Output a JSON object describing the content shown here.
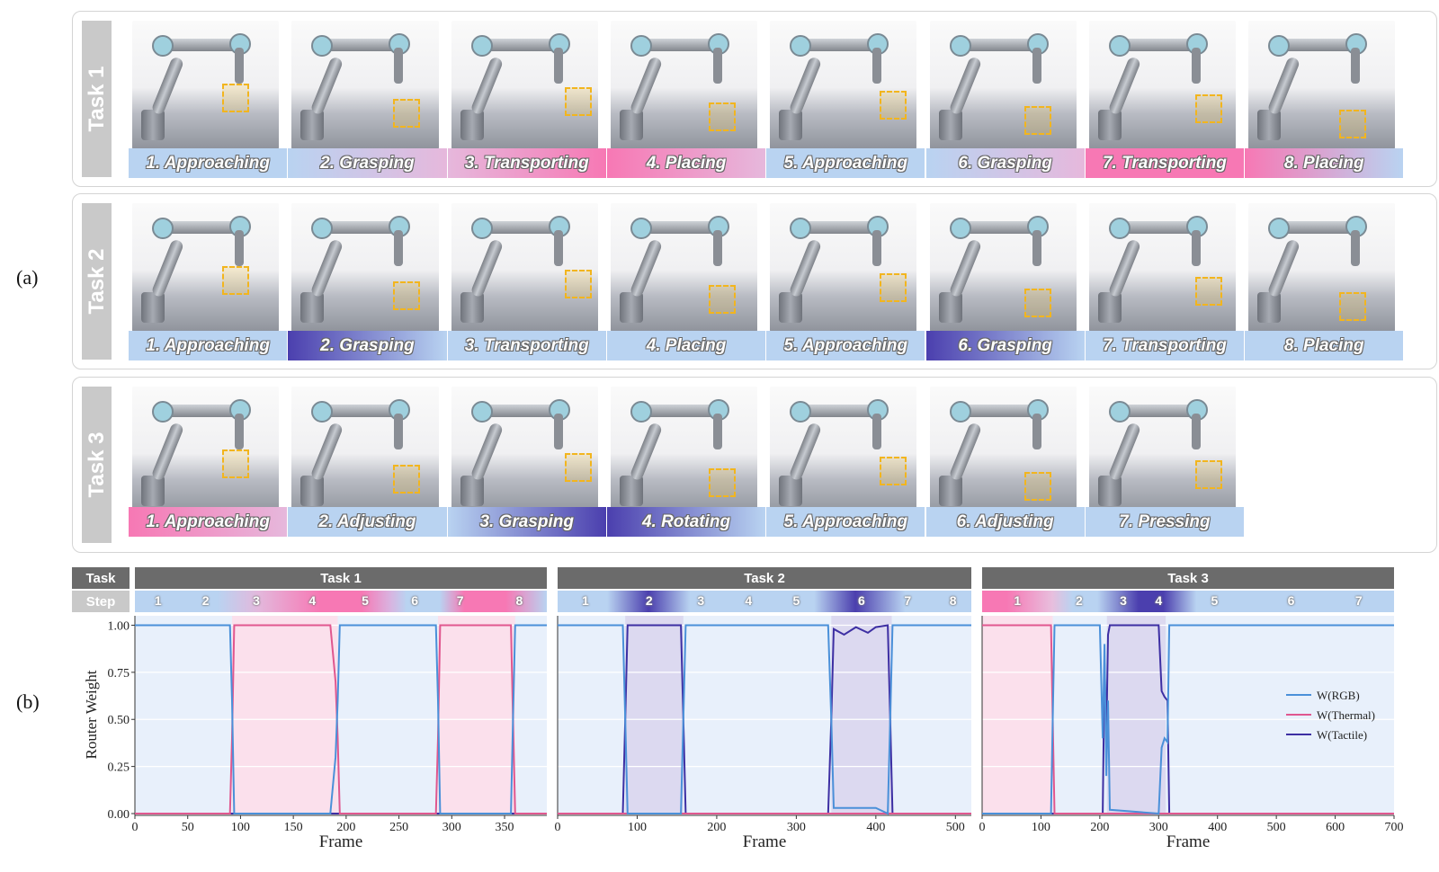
{
  "figure": {
    "label_a": "(a)",
    "label_b": "(b)"
  },
  "colors": {
    "blue": "#b9d3f1",
    "pink": "#f778b4",
    "purple": "#4b3fae",
    "rgb_line": "#4a90d9",
    "thermal_line": "#e0578f",
    "tactile_line": "#3d2fa3"
  },
  "tasks": [
    {
      "name": "Task 1",
      "steps": [
        {
          "label": "1. Approaching",
          "grad": [
            "blue",
            "blue"
          ]
        },
        {
          "label": "2. Grasping",
          "grad": [
            "blue",
            "lightpink"
          ]
        },
        {
          "label": "3. Transporting",
          "grad": [
            "lightpink",
            "pink"
          ]
        },
        {
          "label": "4. Placing",
          "grad": [
            "pink",
            "lightpink"
          ]
        },
        {
          "label": "5. Approaching",
          "grad": [
            "blue",
            "blue"
          ]
        },
        {
          "label": "6. Grasping",
          "grad": [
            "blue",
            "lightpink"
          ]
        },
        {
          "label": "7. Transporting",
          "grad": [
            "pink",
            "pink"
          ]
        },
        {
          "label": "8. Placing",
          "grad": [
            "pink",
            "blue"
          ]
        }
      ]
    },
    {
      "name": "Task 2",
      "steps": [
        {
          "label": "1. Approaching",
          "grad": [
            "blue",
            "blue"
          ]
        },
        {
          "label": "2. Grasping",
          "grad": [
            "purple",
            "blue"
          ]
        },
        {
          "label": "3. Transporting",
          "grad": [
            "blue",
            "blue"
          ]
        },
        {
          "label": "4. Placing",
          "grad": [
            "blue",
            "blue"
          ]
        },
        {
          "label": "5. Approaching",
          "grad": [
            "blue",
            "blue"
          ]
        },
        {
          "label": "6. Grasping",
          "grad": [
            "purple",
            "blue"
          ]
        },
        {
          "label": "7. Transporting",
          "grad": [
            "blue",
            "blue"
          ]
        },
        {
          "label": "8. Placing",
          "grad": [
            "blue",
            "blue"
          ]
        }
      ]
    },
    {
      "name": "Task 3",
      "steps": [
        {
          "label": "1. Approaching",
          "grad": [
            "pink",
            "lightpink"
          ]
        },
        {
          "label": "2. Adjusting",
          "grad": [
            "blue",
            "blue"
          ]
        },
        {
          "label": "3. Grasping",
          "grad": [
            "blue",
            "purple"
          ]
        },
        {
          "label": "4. Rotating",
          "grad": [
            "purple",
            "blue"
          ]
        },
        {
          "label": "5. Approaching",
          "grad": [
            "blue",
            "blue"
          ]
        },
        {
          "label": "6. Adjusting",
          "grad": [
            "blue",
            "blue"
          ]
        },
        {
          "label": "7. Pressing",
          "grad": [
            "blue",
            "blue"
          ]
        }
      ]
    }
  ],
  "band_labels": {
    "task": "Task",
    "step": "Step"
  },
  "chart_data": [
    {
      "type": "line",
      "task": "Task 1",
      "xlabel": "Frame",
      "ylabel": "Router Weight",
      "xlim": [
        0,
        390
      ],
      "ylim": [
        0,
        1.05
      ],
      "xticks": [
        0,
        50,
        100,
        150,
        200,
        250,
        300,
        350
      ],
      "yticks": [
        0,
        0.25,
        0.5,
        0.75,
        1.0
      ],
      "step_positions": [
        22,
        67,
        115,
        168,
        218,
        265,
        308,
        364
      ],
      "step_labels": [
        "1",
        "2",
        "3",
        "4",
        "5",
        "6",
        "7",
        "8"
      ],
      "shaded": [
        {
          "from": 92,
          "to": 192,
          "mod": "thermal"
        },
        {
          "from": 287,
          "to": 360,
          "mod": "thermal"
        }
      ],
      "series": [
        {
          "name": "W(RGB)",
          "x": [
            0,
            90,
            92,
            94,
            185,
            190,
            192,
            194,
            285,
            287,
            289,
            356,
            358,
            360,
            362,
            390
          ],
          "values": [
            1,
            1,
            0.6,
            0,
            0,
            0.3,
            0.6,
            1,
            1,
            0.6,
            0,
            0,
            0.5,
            1,
            1,
            1
          ]
        },
        {
          "name": "W(Thermal)",
          "x": [
            0,
            90,
            92,
            94,
            185,
            190,
            192,
            194,
            285,
            287,
            289,
            356,
            358,
            360,
            362,
            390
          ],
          "values": [
            0,
            0,
            0.4,
            1,
            1,
            0.7,
            0.4,
            0,
            0,
            0.4,
            1,
            1,
            0.5,
            0,
            0,
            0
          ]
        },
        {
          "name": "W(Tactile)",
          "x": [
            0,
            390
          ],
          "values": [
            0,
            0
          ]
        }
      ]
    },
    {
      "type": "line",
      "task": "Task 2",
      "xlabel": "Frame",
      "ylabel": "",
      "xlim": [
        0,
        520
      ],
      "ylim": [
        0,
        1.05
      ],
      "xticks": [
        0,
        100,
        200,
        300,
        400,
        500
      ],
      "yticks": [
        0,
        0.25,
        0.5,
        0.75,
        1.0
      ],
      "step_positions": [
        35,
        115,
        180,
        240,
        300,
        382,
        440,
        497
      ],
      "step_labels": [
        "1",
        "2",
        "3",
        "4",
        "5",
        "6",
        "7",
        "8"
      ],
      "shaded": [
        {
          "from": 85,
          "to": 158,
          "mod": "tactile"
        },
        {
          "from": 344,
          "to": 420,
          "mod": "tactile"
        }
      ],
      "series": [
        {
          "name": "W(RGB)",
          "x": [
            0,
            82,
            85,
            88,
            155,
            158,
            161,
            340,
            344,
            347,
            400,
            415,
            418,
            421,
            520
          ],
          "values": [
            1,
            1,
            0.5,
            0,
            0,
            0.5,
            1,
            1,
            0.5,
            0.03,
            0.03,
            0,
            0.5,
            1,
            1
          ]
        },
        {
          "name": "W(Thermal)",
          "x": [
            0,
            520
          ],
          "values": [
            0,
            0
          ]
        },
        {
          "name": "W(Tactile)",
          "x": [
            0,
            82,
            85,
            88,
            155,
            158,
            161,
            340,
            344,
            347,
            360,
            375,
            390,
            400,
            415,
            418,
            421,
            520
          ],
          "values": [
            0,
            0,
            0.5,
            1,
            1,
            0.5,
            0,
            0,
            0.5,
            0.98,
            0.95,
            0.99,
            0.96,
            0.99,
            1,
            0.5,
            0,
            0
          ]
        }
      ]
    },
    {
      "type": "line",
      "task": "Task 3",
      "xlabel": "Frame",
      "ylabel": "",
      "xlim": [
        0,
        700
      ],
      "ylim": [
        0,
        1.05
      ],
      "xticks": [
        0,
        100,
        200,
        300,
        400,
        500,
        600,
        700
      ],
      "yticks": [
        0,
        0.25,
        0.5,
        0.75,
        1.0
      ],
      "step_positions": [
        60,
        165,
        240,
        300,
        395,
        525,
        640
      ],
      "step_labels": [
        "1",
        "2",
        "3",
        "4",
        "5",
        "6",
        "7"
      ],
      "shaded": [
        {
          "from": 0,
          "to": 120,
          "mod": "thermal"
        },
        {
          "from": 212,
          "to": 312,
          "mod": "tactile"
        }
      ],
      "series": [
        {
          "name": "W(RGB)",
          "x": [
            0,
            117,
            120,
            123,
            200,
            205,
            208,
            211,
            214,
            217,
            300,
            305,
            310,
            315,
            318,
            700
          ],
          "values": [
            0,
            0,
            0.5,
            1,
            1,
            0.4,
            0.9,
            0.2,
            0.6,
            0.02,
            0,
            0.35,
            0.4,
            0.38,
            1,
            1
          ]
        },
        {
          "name": "W(Thermal)",
          "x": [
            0,
            117,
            120,
            123,
            700
          ],
          "values": [
            1,
            1,
            0.5,
            0,
            0
          ]
        },
        {
          "name": "W(Tactile)",
          "x": [
            0,
            205,
            208,
            211,
            214,
            217,
            300,
            305,
            310,
            315,
            318,
            700
          ],
          "values": [
            0,
            0,
            0.8,
            0.4,
            0.95,
            1,
            1,
            0.65,
            0.62,
            0.6,
            0,
            0
          ]
        }
      ]
    }
  ],
  "legend": {
    "rgb": "W(RGB)",
    "thermal": "W(Thermal)",
    "tactile": "W(Tactile)"
  }
}
